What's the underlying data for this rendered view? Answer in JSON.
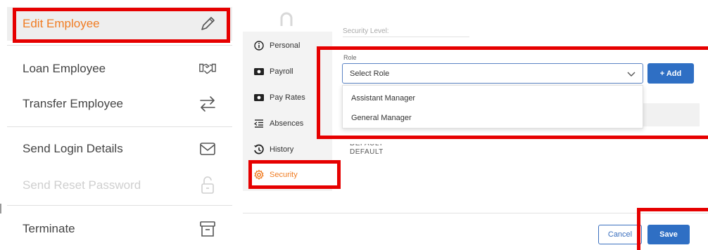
{
  "menu": {
    "items": [
      {
        "label": "Edit Employee",
        "icon": "pencil-icon",
        "state": "active"
      },
      {
        "label": "Loan Employee",
        "icon": "handshake-icon",
        "state": "normal"
      },
      {
        "label": "Transfer Employee",
        "icon": "transfer-arrows-icon",
        "state": "normal"
      },
      {
        "label": "Send Login Details",
        "icon": "envelope-icon",
        "state": "normal"
      },
      {
        "label": "Send Reset Password",
        "icon": "unlock-icon",
        "state": "disabled"
      },
      {
        "label": "Terminate",
        "icon": "archive-box-icon",
        "state": "normal"
      }
    ]
  },
  "tabs": [
    {
      "label": "Personal",
      "icon": "info-icon"
    },
    {
      "label": "Payroll",
      "icon": "money-icon"
    },
    {
      "label": "Pay Rates",
      "icon": "money-icon"
    },
    {
      "label": "Absences",
      "icon": "indent-list-icon"
    },
    {
      "label": "History",
      "icon": "history-icon"
    },
    {
      "label": "Security",
      "icon": "gear-icon",
      "selected": true
    }
  ],
  "security": {
    "level_label": "Security Level:"
  },
  "role": {
    "label": "Role",
    "placeholder": "Select Role",
    "add_label": "+ Add",
    "options": [
      "Assistant Manager",
      "General Manager"
    ]
  },
  "defaults": [
    "DEFAULT",
    "DEFAULT"
  ],
  "footer": {
    "cancel_label": "Cancel",
    "save_label": "Save"
  },
  "colors": {
    "accent_orange": "#f07c22",
    "primary_blue": "#2f6fc4",
    "annotation_red": "#e60000"
  }
}
